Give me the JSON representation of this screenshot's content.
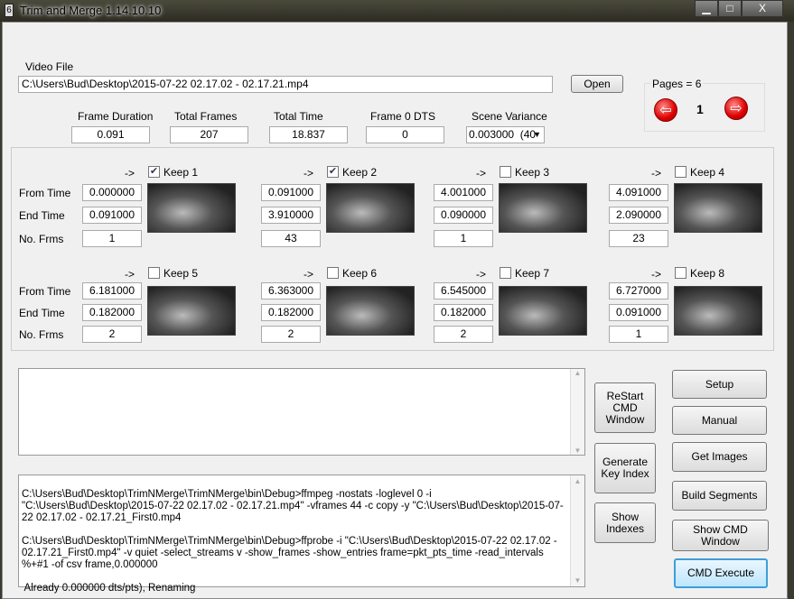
{
  "window": {
    "title": "Trim and Merge 1.14.10.10",
    "minimize": "▁",
    "maximize": "□",
    "close": "X"
  },
  "video": {
    "label": "Video File",
    "path": "C:\\Users\\Bud\\Desktop\\2015-07-22 02.17.02 - 02.17.21.mp4",
    "open": "Open"
  },
  "pages": {
    "label": "Pages = 6",
    "current": "1",
    "prev_icon": "⇦",
    "next_icon": "⇨"
  },
  "stats": {
    "frame_duration_label": "Frame Duration",
    "frame_duration": "0.091",
    "total_frames_label": "Total Frames",
    "total_frames": "207",
    "total_time_label": "Total Time",
    "total_time": "18.837",
    "frame0_label": "Frame 0 DTS",
    "frame0": "0",
    "scene_label": "Scene Variance",
    "scene": "0.003000  (40"
  },
  "row_labels": {
    "from": "From Time",
    "end": "End Time",
    "frms": "No. Frms"
  },
  "arrow": "->",
  "segments": [
    {
      "keep": "Keep 1",
      "checked": true,
      "from": "0.000000",
      "end": "0.091000",
      "frms": "1"
    },
    {
      "keep": "Keep 2",
      "checked": true,
      "from": "0.091000",
      "end": "3.910000",
      "frms": "43"
    },
    {
      "keep": "Keep 3",
      "checked": false,
      "from": "4.001000",
      "end": "0.090000",
      "frms": "1"
    },
    {
      "keep": "Keep 4",
      "checked": false,
      "from": "4.091000",
      "end": "2.090000",
      "frms": "23"
    },
    {
      "keep": "Keep 5",
      "checked": false,
      "from": "6.181000",
      "end": "0.182000",
      "frms": "2"
    },
    {
      "keep": "Keep 6",
      "checked": false,
      "from": "6.363000",
      "end": "0.182000",
      "frms": "2"
    },
    {
      "keep": "Keep 7",
      "checked": false,
      "from": "6.545000",
      "end": "0.182000",
      "frms": "2"
    },
    {
      "keep": "Keep 8",
      "checked": false,
      "from": "6.727000",
      "end": "0.091000",
      "frms": "1"
    }
  ],
  "log": [
    "C:\\Users\\Bud\\Desktop\\TrimNMerge\\TrimNMerge\\bin\\Debug>ffmpeg -nostats -loglevel 0 -i \"C:\\Users\\Bud\\Desktop\\2015-07-22 02.17.02 - 02.17.21.mp4\" -vframes 44 -c copy -y \"C:\\Users\\Bud\\Desktop\\2015-07-22 02.17.02 - 02.17.21_First0.mp4",
    "C:\\Users\\Bud\\Desktop\\TrimNMerge\\TrimNMerge\\bin\\Debug>ffprobe -i \"C:\\Users\\Bud\\Desktop\\2015-07-22 02.17.02 - 02.17.21_First0.mp4\" -v quiet -select_streams v -show_frames -show_entries frame=pkt_pts_time -read_intervals %+#1 -of csv frame,0.000000",
    " Already 0.000000 dts/pts), Renaming"
  ],
  "buttons": {
    "restart": "ReStart CMD Window",
    "genkey": "Generate Key Index",
    "showidx": "Show Indexes",
    "setup": "Setup",
    "manual": "Manual",
    "getimages": "Get Images",
    "build": "Build Segments",
    "showcmd": "Show CMD Window",
    "execute": "CMD Execute"
  }
}
